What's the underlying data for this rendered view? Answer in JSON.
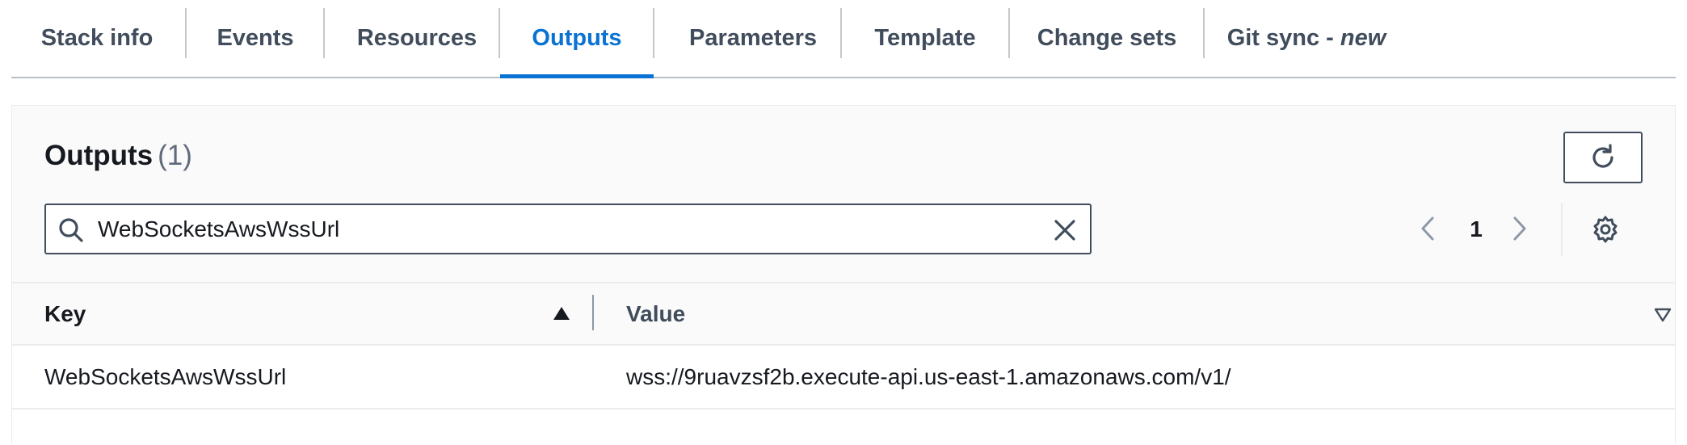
{
  "tabs": [
    {
      "label": "Stack info"
    },
    {
      "label": "Events"
    },
    {
      "label": "Resources"
    },
    {
      "label": "Outputs",
      "active": true
    },
    {
      "label": "Parameters"
    },
    {
      "label": "Template"
    },
    {
      "label": "Change sets"
    },
    {
      "label": "Git sync - ",
      "badge": "new"
    }
  ],
  "panel": {
    "title": "Outputs",
    "count": "(1)",
    "refresh_icon": "refresh-icon"
  },
  "search": {
    "value": "WebSocketsAwsWssUrl",
    "placeholder": "Search outputs",
    "icon": "search-icon",
    "clear_icon": "close-icon"
  },
  "pagination": {
    "current_page": "1",
    "prev_icon": "chevron-left-icon",
    "next_icon": "chevron-right-icon",
    "settings_icon": "gear-icon"
  },
  "table": {
    "columns": [
      {
        "label": "Key",
        "sort": "ascending"
      },
      {
        "label": "Value"
      }
    ],
    "rows": [
      {
        "key": "WebSocketsAwsWssUrl",
        "value": "wss://9ruavzsf2b.execute-api.us-east-1.amazonaws.com/v1/"
      }
    ]
  },
  "colors": {
    "accent": "#0972d3",
    "text": "#16191f",
    "muted": "#414d5c",
    "border": "#b6bec9"
  }
}
